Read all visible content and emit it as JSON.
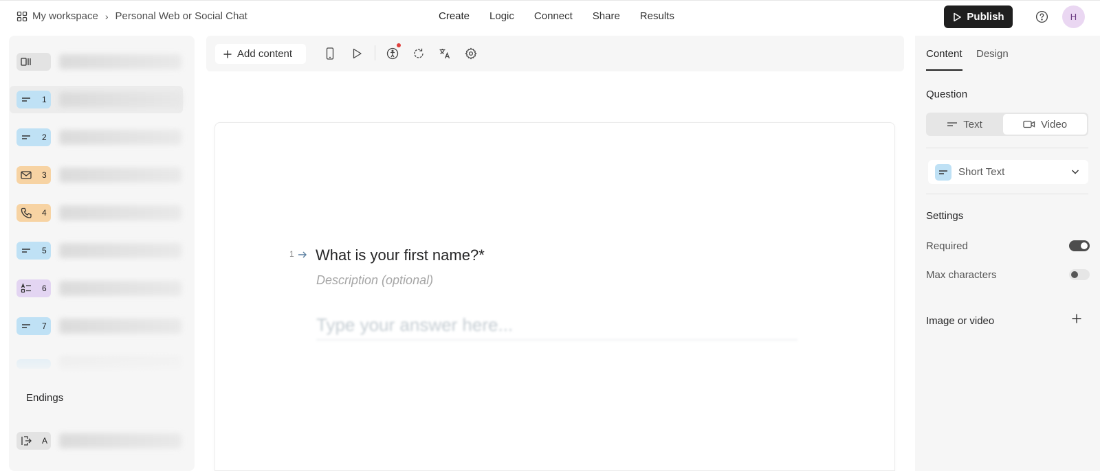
{
  "header": {
    "breadcrumb_workspace": "My workspace",
    "breadcrumb_form": "Personal Web or Social Chat",
    "nav": [
      "Create",
      "Logic",
      "Connect",
      "Share",
      "Results"
    ],
    "publish_label": "Publish",
    "avatar_initial": "H"
  },
  "sidebar": {
    "items": [
      {
        "badge": "",
        "icon": "welcome-screen-icon",
        "color": "gray"
      },
      {
        "badge": "1",
        "icon": "short-text-icon",
        "color": "blue"
      },
      {
        "badge": "2",
        "icon": "short-text-icon",
        "color": "blue"
      },
      {
        "badge": "3",
        "icon": "email-icon",
        "color": "orange"
      },
      {
        "badge": "4",
        "icon": "phone-icon",
        "color": "orange"
      },
      {
        "badge": "5",
        "icon": "short-text-icon",
        "color": "blue"
      },
      {
        "badge": "6",
        "icon": "multiple-choice-icon",
        "color": "purple"
      },
      {
        "badge": "7",
        "icon": "short-text-icon",
        "color": "blue"
      }
    ],
    "endings_label": "Endings",
    "ending_badge": "A"
  },
  "toolbar": {
    "add_content_label": "Add content",
    "icons": [
      "mobile-preview-icon",
      "play-icon",
      "accessibility-icon",
      "refresh-icon",
      "translate-icon",
      "settings-icon"
    ]
  },
  "question": {
    "number": "1",
    "title": "What is your first name?*",
    "description_placeholder": "Description (optional)",
    "answer_placeholder": "Type your answer here..."
  },
  "panel": {
    "tabs": [
      "Content",
      "Design"
    ],
    "question_label": "Question",
    "segment_text": "Text",
    "segment_video": "Video",
    "question_type": "Short Text",
    "settings_label": "Settings",
    "required_label": "Required",
    "required_on": true,
    "max_chars_label": "Max characters",
    "max_chars_on": false,
    "image_video_label": "Image or video"
  },
  "colors": {
    "accent_dark": "#1f1f1f",
    "badge_blue": "#bfe1f5",
    "badge_orange": "#f7d3a3",
    "badge_purple": "#e3d5f2",
    "avatar_bg": "#ead7f2",
    "notification_red": "#e0403d"
  }
}
